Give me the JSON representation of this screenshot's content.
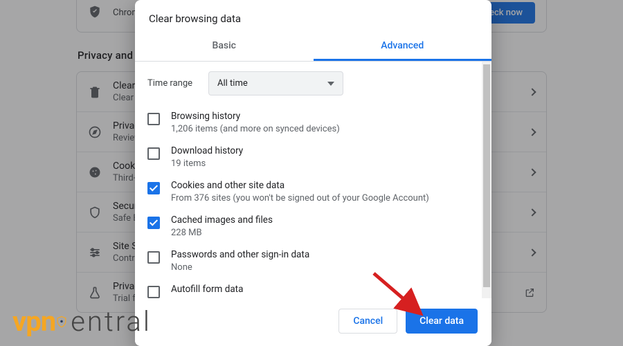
{
  "colors": {
    "accent": "#1a73e8",
    "brand_orange": "#f5a623"
  },
  "callout": {
    "text": "Chrome can help keep you safe from data breaches, bad extensions, and more",
    "button": "Check now"
  },
  "section_title": "Privacy and security",
  "bg_rows": [
    {
      "id": "clear",
      "title": "Clear browsing data",
      "sub": "Clear history, cookies, cache, and more"
    },
    {
      "id": "guide",
      "title": "Privacy Guide",
      "sub": "Review key privacy and security controls"
    },
    {
      "id": "cookies",
      "title": "Cookies and other site data",
      "sub": "Third-party cookies are blocked in Incognito mode"
    },
    {
      "id": "security",
      "title": "Security",
      "sub": "Safe Browsing (protection from dangerous sites) and other security settings"
    },
    {
      "id": "site",
      "title": "Site Settings",
      "sub": "Controls what information sites can use and show"
    },
    {
      "id": "sandbox",
      "title": "Privacy Sandbox",
      "sub": "Trial features are on"
    }
  ],
  "dialog": {
    "title": "Clear browsing data",
    "tabs": {
      "basic": "Basic",
      "advanced": "Advanced",
      "active": "advanced"
    },
    "time_range_label": "Time range",
    "time_range_value": "All time",
    "options": [
      {
        "id": "browsing",
        "checked": false,
        "title": "Browsing history",
        "sub": "1,206 items (and more on synced devices)"
      },
      {
        "id": "downloads",
        "checked": false,
        "title": "Download history",
        "sub": "19 items"
      },
      {
        "id": "cookies",
        "checked": true,
        "title": "Cookies and other site data",
        "sub": "From 376 sites (you won't be signed out of your Google Account)"
      },
      {
        "id": "cache",
        "checked": true,
        "title": "Cached images and files",
        "sub": "228 MB"
      },
      {
        "id": "passwords",
        "checked": false,
        "title": "Passwords and other sign-in data",
        "sub": "None"
      },
      {
        "id": "autofill",
        "checked": false,
        "title": "Autofill form data",
        "sub": ""
      }
    ],
    "cancel": "Cancel",
    "confirm": "Clear data"
  },
  "watermark": {
    "part1": "vpn",
    "part2": "entral"
  }
}
